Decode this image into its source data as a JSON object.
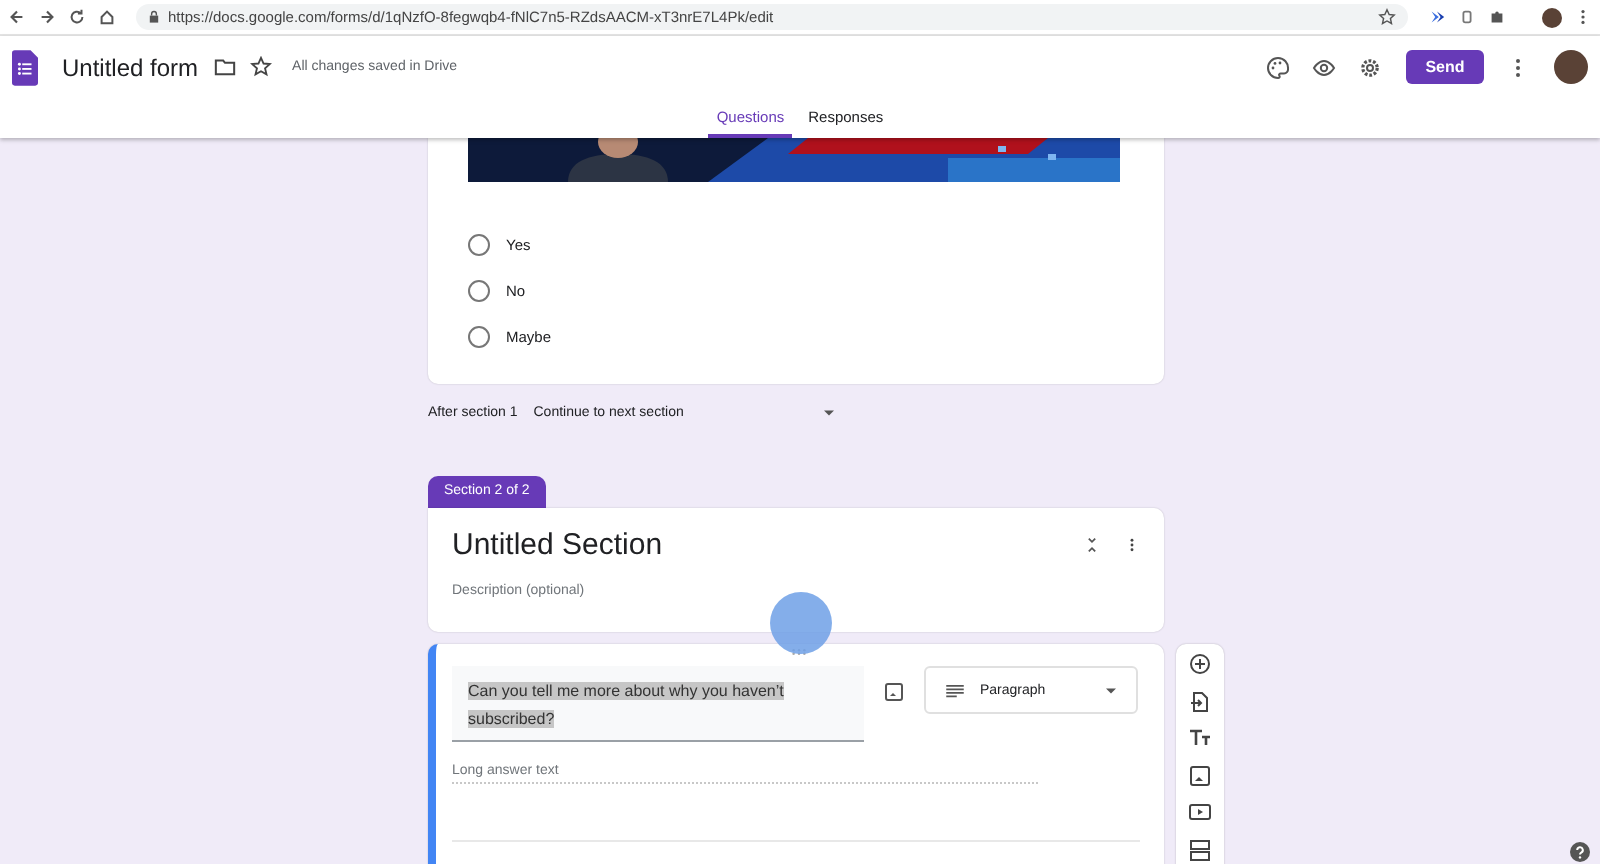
{
  "browser": {
    "url": "https://docs.google.com/forms/d/1qNzfO-8fegwqb4-fNlC7n5-RZdsAACM-xT3nrE7L4Pk/edit"
  },
  "header": {
    "title": "Untitled form",
    "save_status": "All changes saved in Drive",
    "send_label": "Send"
  },
  "tabs": [
    {
      "label": "Questions",
      "selected": true
    },
    {
      "label": "Responses",
      "selected": false
    }
  ],
  "question1": {
    "options": [
      {
        "label": "Yes",
        "selected": false
      },
      {
        "label": "No",
        "selected": false
      },
      {
        "label": "Maybe",
        "selected": false
      }
    ]
  },
  "after_section": {
    "label": "After section 1",
    "value": "Continue to next section"
  },
  "section": {
    "badge": "Section 2 of 2",
    "title": "Untitled Section",
    "description_placeholder": "Description (optional)"
  },
  "question2": {
    "title": "Can you tell me more about why you haven’t subscribed?",
    "title_highlighted": true,
    "type": "Paragraph",
    "answer_placeholder": "Long answer text"
  }
}
